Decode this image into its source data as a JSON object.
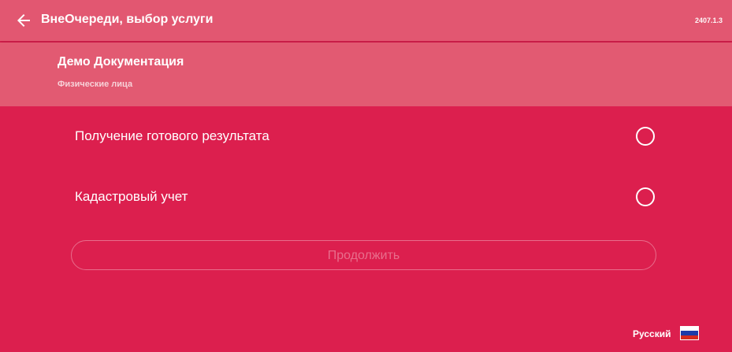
{
  "header": {
    "title": "ВнеОчереди, выбор услуги",
    "version": "2407.1.3",
    "back_icon": "arrow-left-icon"
  },
  "organization": {
    "name": "Демо Документация",
    "subtitle": "Физические лица"
  },
  "services": [
    {
      "label": "Получение готового результата",
      "selected": false
    },
    {
      "label": "Кадастровый учет",
      "selected": false
    }
  ],
  "continue_button": {
    "label": "Продолжить",
    "enabled": false
  },
  "language": {
    "label": "Русский",
    "flag": "russia-flag-icon"
  },
  "colors": {
    "background": "#dc1f4e",
    "topbar": "#e25771",
    "header_panel": "#e25a72",
    "text": "#ffffff"
  }
}
